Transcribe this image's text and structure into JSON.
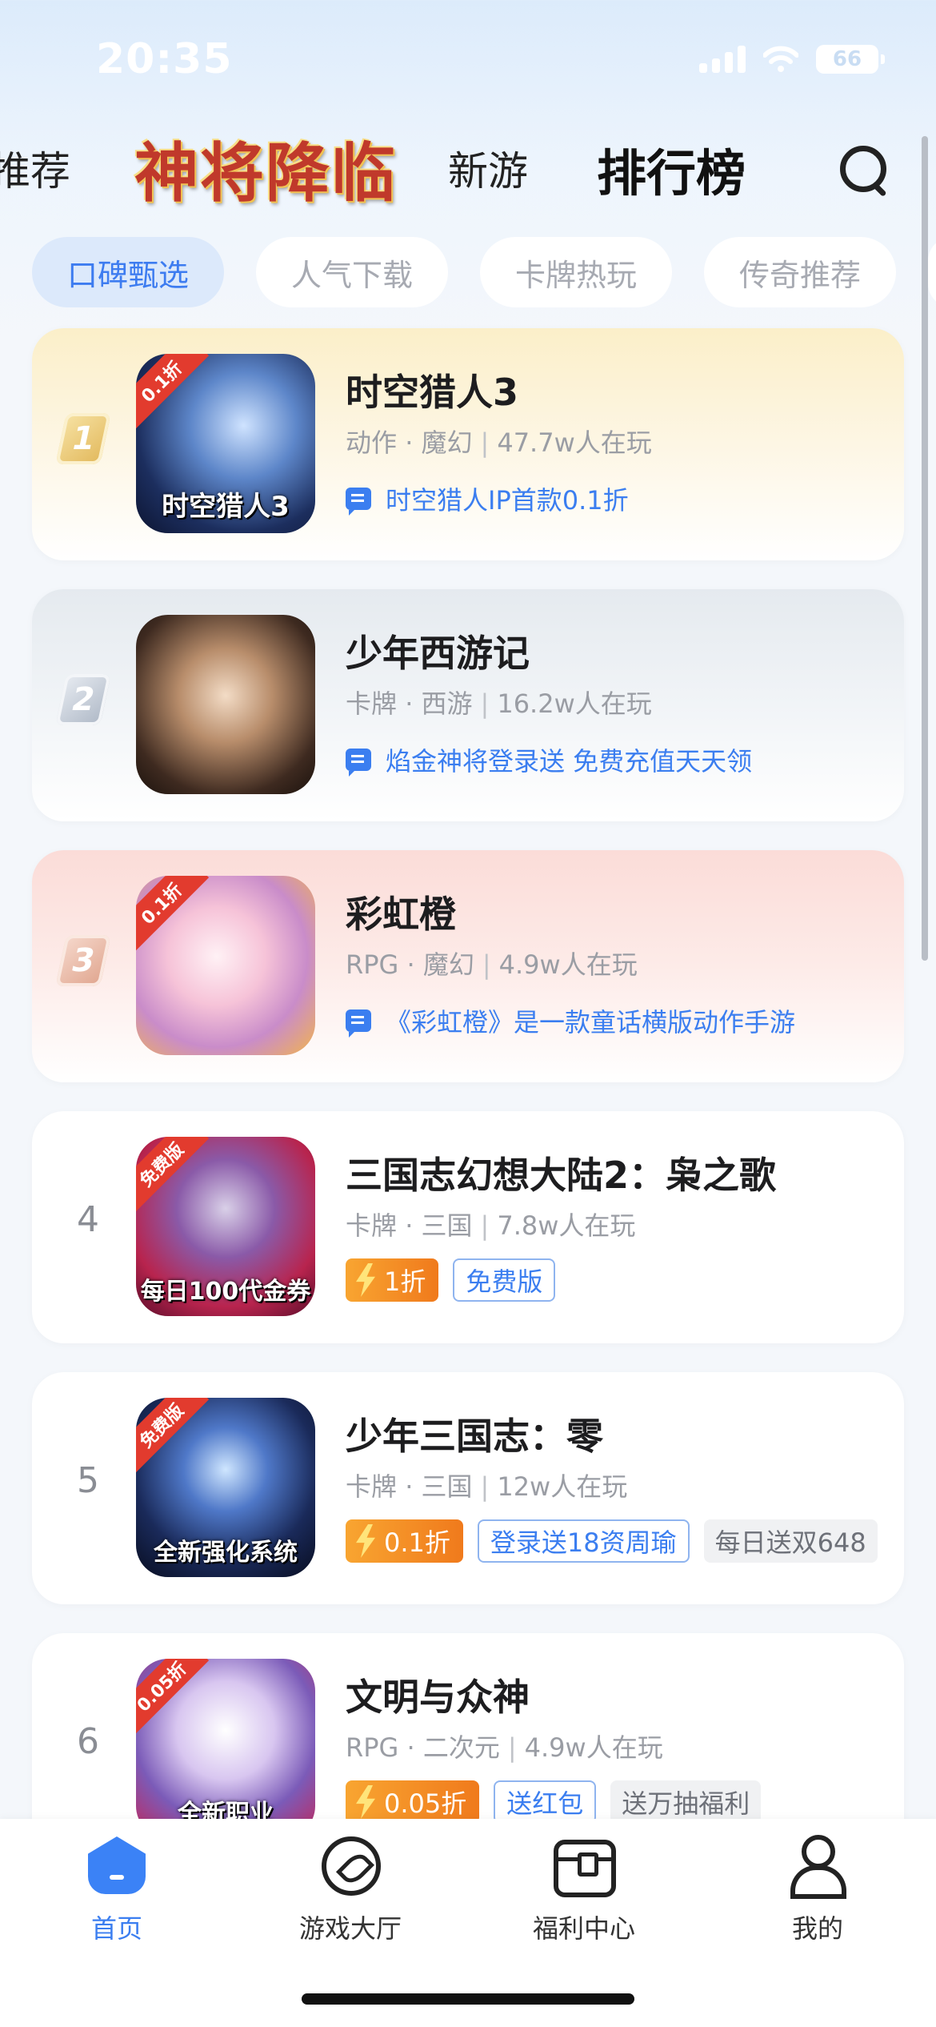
{
  "status_bar": {
    "time": "20:35",
    "battery": "66"
  },
  "top_nav": {
    "left_partial": "推荐",
    "banner": "神将降临",
    "new_games": "新游",
    "ranking": "排行榜"
  },
  "chips": [
    "口碑甄选",
    "人气下载",
    "卡牌热玩",
    "传奇推荐"
  ],
  "games": [
    {
      "rank": "1",
      "title": "时空猎人3",
      "genre": "动作",
      "theme": "魔幻",
      "players": "47.7w人在玩",
      "desc": "时空猎人IP首款0.1折",
      "corner": "0.1折",
      "caption": "时空猎人3"
    },
    {
      "rank": "2",
      "title": "少年西游记",
      "genre": "卡牌",
      "theme": "西游",
      "players": "16.2w人在玩",
      "desc": "焰金神将登录送 免费充值天天领",
      "corner": "",
      "caption": ""
    },
    {
      "rank": "3",
      "title": "彩虹橙",
      "genre": "RPG",
      "theme": "魔幻",
      "players": "4.9w人在玩",
      "desc": "《彩虹橙》是一款童话横版动作手游",
      "corner": "0.1折",
      "caption": ""
    },
    {
      "rank": "4",
      "title": "三国志幻想大陆2：枭之歌",
      "genre": "卡牌",
      "theme": "三国",
      "players": "7.8w人在玩",
      "discount": "1折",
      "tag1": "免费版",
      "tag2": "",
      "corner": "免费版",
      "caption": "每日100代金券"
    },
    {
      "rank": "5",
      "title": "少年三国志：零",
      "genre": "卡牌",
      "theme": "三国",
      "players": "12w人在玩",
      "discount": "0.1折",
      "tag1": "登录送18资周瑜",
      "tag2": "每日送双648",
      "corner": "免费版",
      "caption": "全新强化系统"
    },
    {
      "rank": "6",
      "title": "文明与众神",
      "genre": "RPG",
      "theme": "二次元",
      "players": "4.9w人在玩",
      "discount": "0.05折",
      "tag1": "送红包",
      "tag2": "送万抽福利",
      "corner": "0.05折",
      "caption": "全新职业"
    }
  ],
  "tabbar": {
    "home": "首页",
    "game_hall": "游戏大厅",
    "welfare": "福利中心",
    "mine": "我的"
  },
  "colors": {
    "accent": "#3b7ef0",
    "discount": "#f07a1c",
    "gold": "#fbefc9",
    "silver": "#e5eaef",
    "bronze": "#fbdcd8"
  }
}
